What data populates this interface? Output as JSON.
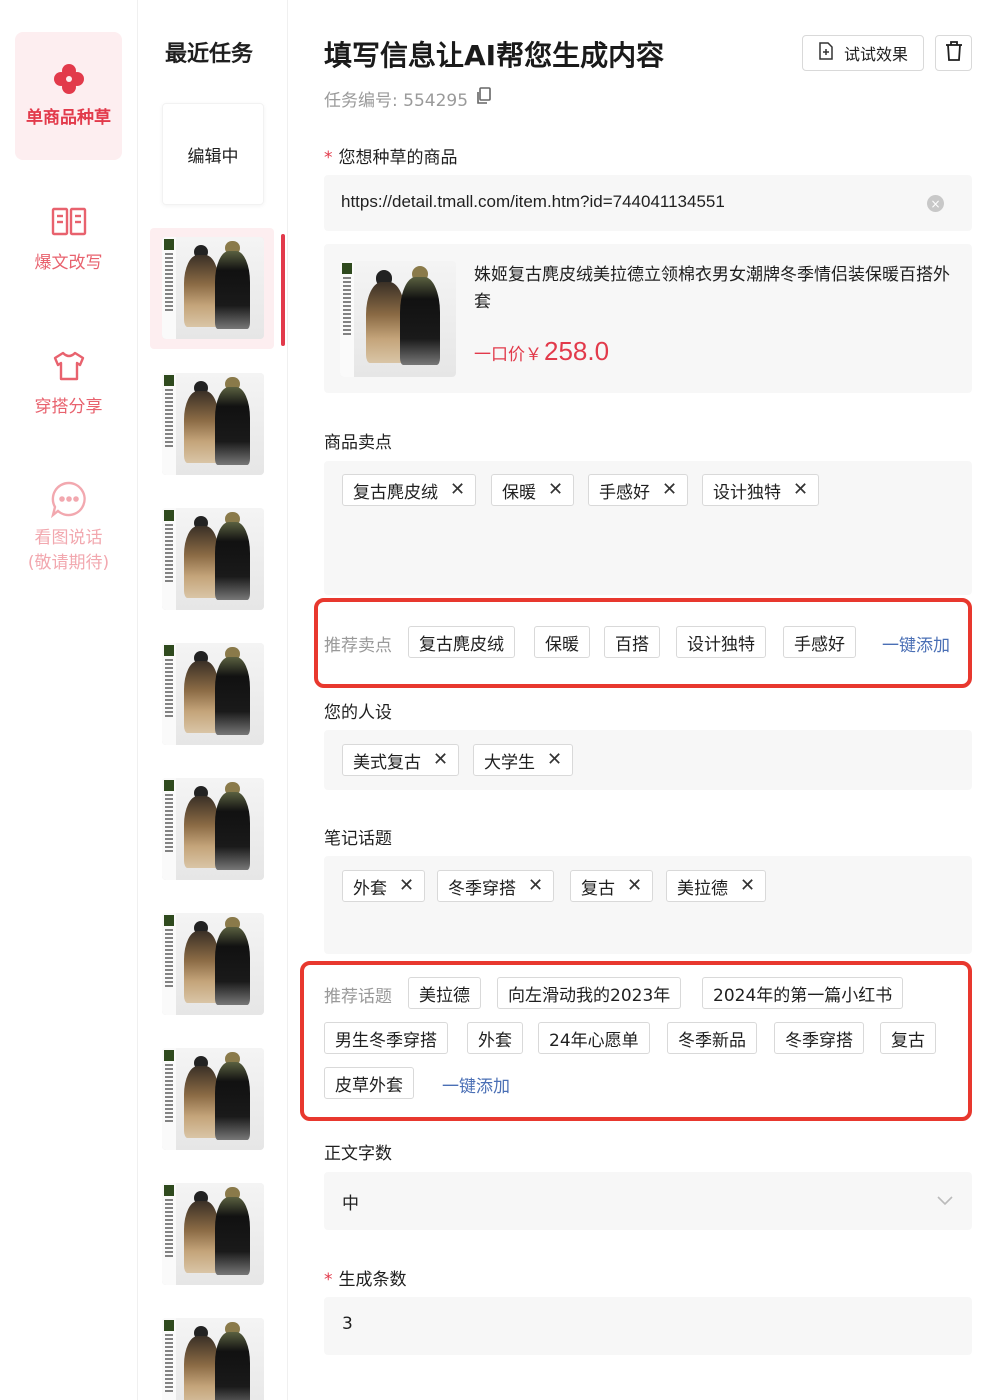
{
  "nav": {
    "items": [
      {
        "label": "单商品种草",
        "icon": "clover-icon",
        "active": true
      },
      {
        "label": "爆文改写",
        "icon": "book-icon"
      },
      {
        "label": "穿搭分享",
        "icon": "shirt-icon"
      },
      {
        "label_line1": "看图说话",
        "label_line2": "(敬请期待)",
        "icon": "chat-bubble-icon",
        "disabled": true
      }
    ]
  },
  "tasks": {
    "title": "最近任务",
    "draft_label": "编辑中",
    "thumb_count": 9
  },
  "header": {
    "title": "填写信息让AI帮您生成内容",
    "task_no": "任务编号: 554295",
    "try_button": "试试效果"
  },
  "product": {
    "label": "您想种草的商品",
    "url": "https://detail.tmall.com/item.htm?id=744041134551",
    "name": "姝姬复古麂皮绒美拉德立领棉衣男女潮牌冬季情侣装保暖百搭外套",
    "price_label": "一口价￥",
    "price_value": "258.0"
  },
  "selling_points": {
    "label": "商品卖点",
    "tags": [
      "复古麂皮绒",
      "保暖",
      "手感好",
      "设计独特"
    ],
    "rec_label": "推荐卖点",
    "rec_tags": [
      "复古麂皮绒",
      "保暖",
      "百搭",
      "设计独特",
      "手感好"
    ],
    "rec_add": "一键添加"
  },
  "persona": {
    "label": "您的人设",
    "tags": [
      "美式复古",
      "大学生"
    ]
  },
  "topics": {
    "label": "笔记话题",
    "tags": [
      "外套",
      "冬季穿搭",
      "复古",
      "美拉德"
    ],
    "rec_label": "推荐话题",
    "rec_tags": [
      "美拉德",
      "向左滑动我的2023年",
      "2024年的第一篇小红书",
      "男生冬季穿搭",
      "外套",
      "24年心愿单",
      "冬季新品",
      "冬季穿搭",
      "复古",
      "皮草外套"
    ],
    "rec_add": "一键添加"
  },
  "word_count": {
    "label": "正文字数",
    "value": "中"
  },
  "count": {
    "label": "生成条数",
    "value": "3"
  },
  "colors": {
    "accent": "#e23a4b",
    "highlight_frame": "#e8382e",
    "link": "#4a6fb5"
  }
}
